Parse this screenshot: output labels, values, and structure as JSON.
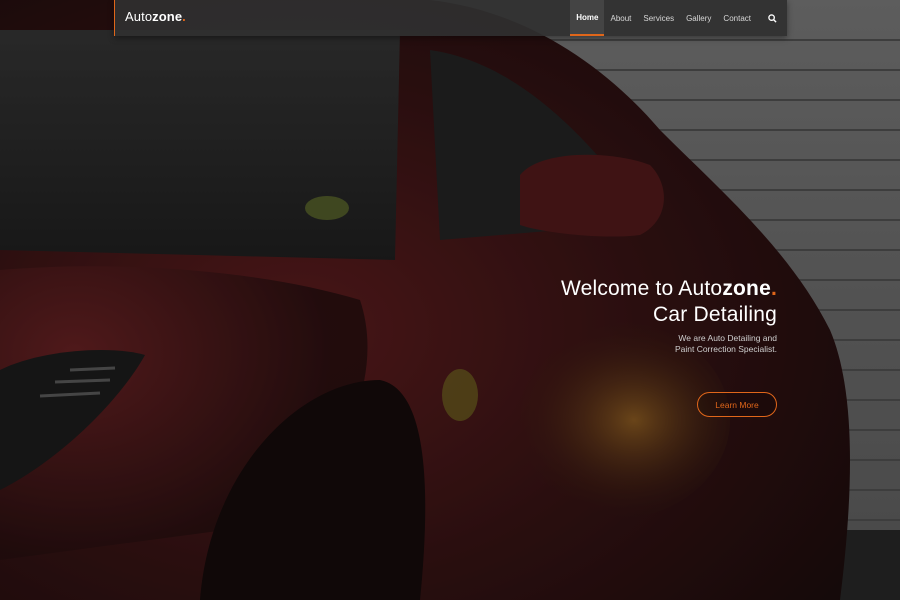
{
  "navbar": {
    "logo": {
      "light": "Auto",
      "bold": "zone",
      "dot": "."
    },
    "items": [
      {
        "label": "Home",
        "active": true
      },
      {
        "label": "About",
        "active": false
      },
      {
        "label": "Services",
        "active": false
      },
      {
        "label": "Gallery",
        "active": false
      },
      {
        "label": "Contact",
        "active": false
      }
    ],
    "search_icon": "search-icon"
  },
  "hero": {
    "title_line1_prefix": "Welcome to Auto",
    "title_line1_bold": "zone",
    "title_line1_dot": ".",
    "title_line2": "Car Detailing",
    "subtitle_line1": "We are Auto Detailing and",
    "subtitle_line2": "Paint Correction Specialist.",
    "cta_label": "Learn More"
  },
  "colors": {
    "accent": "#e0661a",
    "navbar_bg": "#303030",
    "text": "#ffffff"
  }
}
